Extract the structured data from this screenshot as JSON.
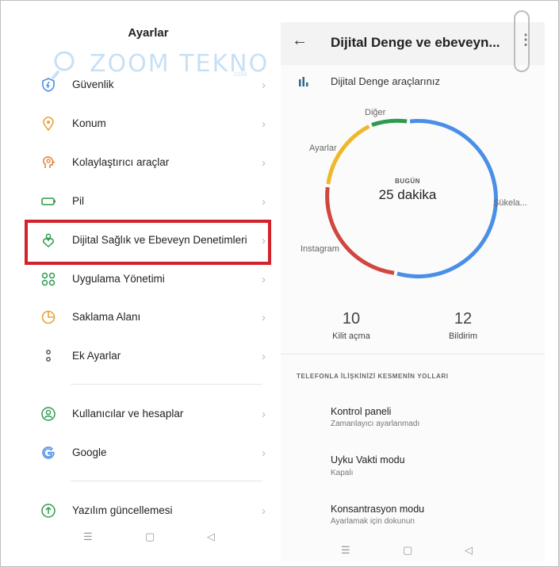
{
  "watermark": {
    "text": "ZOOM TEKNO",
    "sub": ".COM"
  },
  "left": {
    "title": "Ayarlar",
    "items": [
      {
        "label": "Güvenlik",
        "icon": "shield-icon"
      },
      {
        "label": "Konum",
        "icon": "location-icon"
      },
      {
        "label": "Kolaylaştırıcı araçlar",
        "icon": "accessibility-icon"
      },
      {
        "label": "Pil",
        "icon": "battery-icon"
      },
      {
        "label": "Dijital Sağlık ve Ebeveyn Denetimleri",
        "icon": "digital-wellbeing-icon"
      },
      {
        "label": "Uygulama Yönetimi",
        "icon": "apps-icon"
      },
      {
        "label": "Saklama Alanı",
        "icon": "storage-icon"
      },
      {
        "label": "Ek Ayarlar",
        "icon": "more-settings-icon"
      },
      {
        "label": "Kullanıcılar ve hesaplar",
        "icon": "users-icon"
      },
      {
        "label": "Google",
        "icon": "google-icon"
      },
      {
        "label": "Yazılım güncellemesi",
        "icon": "update-icon"
      }
    ],
    "chevron": "›",
    "nav": {
      "menu": "☰",
      "home": "▢",
      "back": "◁"
    }
  },
  "right": {
    "back": "←",
    "title": "Dijital Denge ve ebeveyn...",
    "menu": "⋮",
    "tools_label": "Dijital Denge araçlarınız",
    "chart": {
      "center_top": "BUGÜN",
      "center_value": "25 dakika",
      "labels": {
        "other": "Diğer",
        "settings": "Ayarlar",
        "instagram": "Instagram",
        "sukela": "Şükela..."
      }
    },
    "stats": [
      {
        "value": "10",
        "label": "Kilit açma"
      },
      {
        "value": "12",
        "label": "Bildirim"
      }
    ],
    "section_header": "TELEFONLA İLİŞKİNİZİ KESMENİN YOLLARI",
    "items": [
      {
        "title": "Kontrol paneli",
        "subtitle": "Zamanlayıcı ayarlanmadı"
      },
      {
        "title": "Uyku Vakti modu",
        "subtitle": "Kapalı"
      },
      {
        "title": "Konsantrasyon modu",
        "subtitle": "Ayarlamak için dokunun"
      }
    ],
    "nav": {
      "menu": "☰",
      "home": "▢",
      "back": "◁"
    }
  },
  "colors": {
    "blue": "#4a8fe7",
    "red": "#d0473f",
    "yellow": "#f0b829",
    "green": "#2e9a4f",
    "highlight": "#d2232a"
  }
}
